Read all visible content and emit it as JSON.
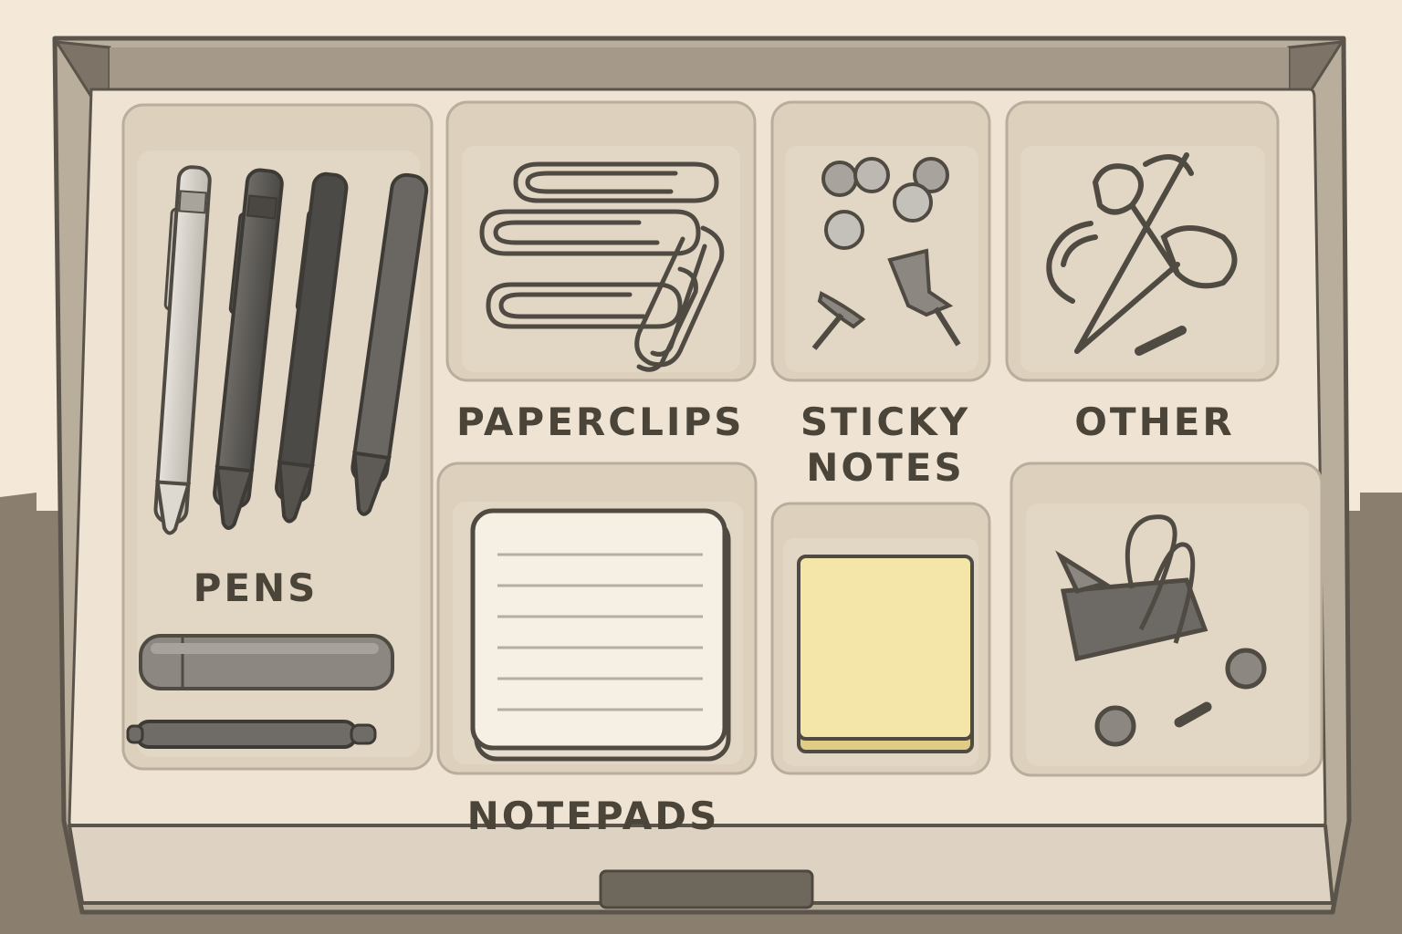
{
  "labels": {
    "pens": "PENS",
    "paperclips": "PAPERCLIPS",
    "sticky_line1": "STICKY",
    "sticky_line2": "NOTES",
    "other": "OTHER",
    "notepads": "NOTEPADS"
  },
  "colors": {
    "background": "#f4e9d8",
    "floor": "#8a7e6e",
    "drawer_outer": "#b9ad9c",
    "drawer_inner": "#efe4d3",
    "tray": "#ddd0bd",
    "outline": "#5b544a",
    "sticky_note": "#f3e6a8"
  },
  "icons": [
    "pen-icon",
    "paperclip-icon",
    "pushpin-icon",
    "thumbtack-icon",
    "scissors-icon",
    "binder-clip-icon",
    "eraser-icon",
    "notepad-icon",
    "sticky-note-icon"
  ]
}
